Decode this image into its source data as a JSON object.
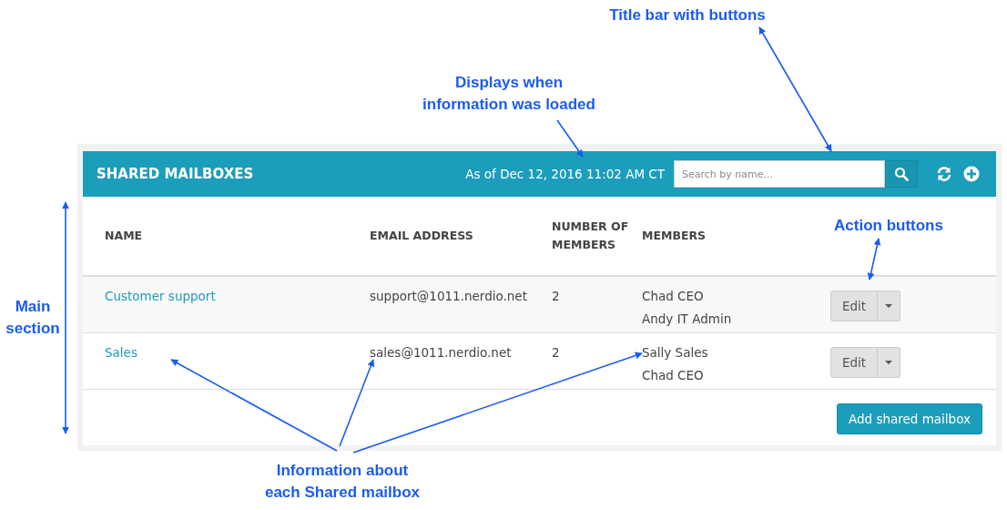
{
  "annotations": [
    {
      "text": "Title bar with buttons"
    },
    {
      "text": "Displays when\ninformation was loaded"
    },
    {
      "text": "Action buttons"
    },
    {
      "text": "Main\nsection"
    },
    {
      "text": "Information about\neach Shared mailbox"
    }
  ],
  "panel": {
    "title": "SHARED MAILBOXES",
    "as_of": "As of Dec 12, 2016 11:02 AM CT",
    "search": {
      "placeholder": "Search by name..."
    }
  },
  "table": {
    "columns": [
      "NAME",
      "EMAIL ADDRESS",
      "NUMBER OF MEMBERS",
      "MEMBERS"
    ],
    "rows": [
      {
        "name": "Customer support",
        "email": "support@1011.nerdio.net",
        "count": "2",
        "members": [
          "Chad CEO",
          "Andy IT Admin"
        ],
        "action": "Edit"
      },
      {
        "name": "Sales",
        "email": "sales@1011.nerdio.net",
        "count": "2",
        "members": [
          "Sally Sales",
          "Chad CEO"
        ],
        "action": "Edit"
      }
    ]
  },
  "add_button": "Add shared mailbox"
}
